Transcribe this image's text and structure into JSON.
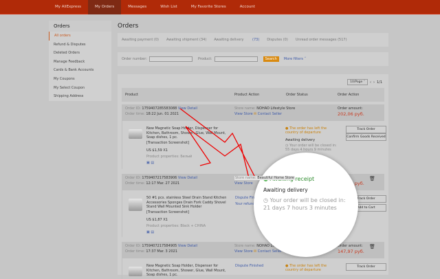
{
  "topnav": [
    "My AliExpress",
    "My Orders",
    "Messages",
    "Wish List",
    "My Favorite Stores",
    "Account"
  ],
  "sidebar": {
    "title": "Orders",
    "items": [
      "All orders",
      "Refund & Disputes",
      "Deleted Orders",
      "Manage Feedback",
      "Cards & Bank Accounts",
      "My Coupons",
      "My Select Coupon",
      "Shipping Address"
    ]
  },
  "page_title": "Orders",
  "tabs": [
    {
      "label": "Awaiting payment (0)"
    },
    {
      "label": "Awaiting shipment (34)"
    },
    {
      "label": "Awaiting delivery",
      "count": "(73)"
    },
    {
      "label": "Disputes (0)"
    },
    {
      "label": "Unread order messages (517)"
    }
  ],
  "filters": {
    "order_number": "Order number:",
    "product": "Product:",
    "search": "Search",
    "more": "More filters ˅"
  },
  "pager": {
    "per_page": "10/Page ˅",
    "page": "1/1"
  },
  "columns": [
    "Product",
    "Product Action",
    "Order Status",
    "Order Action"
  ],
  "labels": {
    "order_id": "Order ID:",
    "order_time": "Order time:",
    "view_detail": "View Detail",
    "store_name": "Store name:",
    "view_store": "View Store",
    "contact_seller": "Contact Seller",
    "order_amount": "Order amount:",
    "screenshot": "[Transaction Screenshot]",
    "track": "Track Order",
    "confirm": "Confirm Goods Received",
    "add_cart": "Add to Cart",
    "dispute": "Dispute Finished",
    "refund": "Your refund progress"
  },
  "orders": [
    {
      "id": "1759407285583088",
      "time": "18:22 Jun. 01 2021",
      "store": "NOHAO Lifestyle Store",
      "amount": "202,06 руб.",
      "product": "New Magnetic Soap Holder, Dispenser for Kitchen, Bathroom, Shower, Glue, Wall Mount, Soap dishes, 1 pc.",
      "price": "US $1,59 X1",
      "props": "Product properties: Белый",
      "status_top": "The order has left the country of departure",
      "status": "Awaiting delivery",
      "closing": "Your order will be closed in: 55 days 4 hours 9 minutes"
    },
    {
      "id": "1759407217583906",
      "time": "12:17 Mar. 27 2021",
      "store": "Beautiful Home Store",
      "amount": "136,59 руб.",
      "product": "50 #1 pcs. stainless Steel Drain Stand Kitchen Accessories Sponges Drain Fork Caddy Shovel Stand Wall Mounted Sink Holder",
      "price": "US $1,87 X1",
      "props": "Product properties: Black + CHINA"
    },
    {
      "id": "1759407217584905",
      "time": "17:37 Mar. 3 2021",
      "store": "NOHAO Lifestyle Store",
      "amount": "147,97 руб.",
      "product": "New Magnetic Soap Holder, Dispenser for Kitchen, Bathroom, Shower, Glue, Wall Mount, Soap dishes, 1 pc.",
      "status_top": "The order has left the country of departure"
    }
  ],
  "magnifier": {
    "status": "Awaiting receipt",
    "sub": "Awaiting delivery",
    "closing": "Your order will be closed in: 21 days 7 hours 3 minutes"
  },
  "colors": {
    "brand": "#b02a08",
    "accent": "#d98a10",
    "green": "#2e8b2e"
  }
}
